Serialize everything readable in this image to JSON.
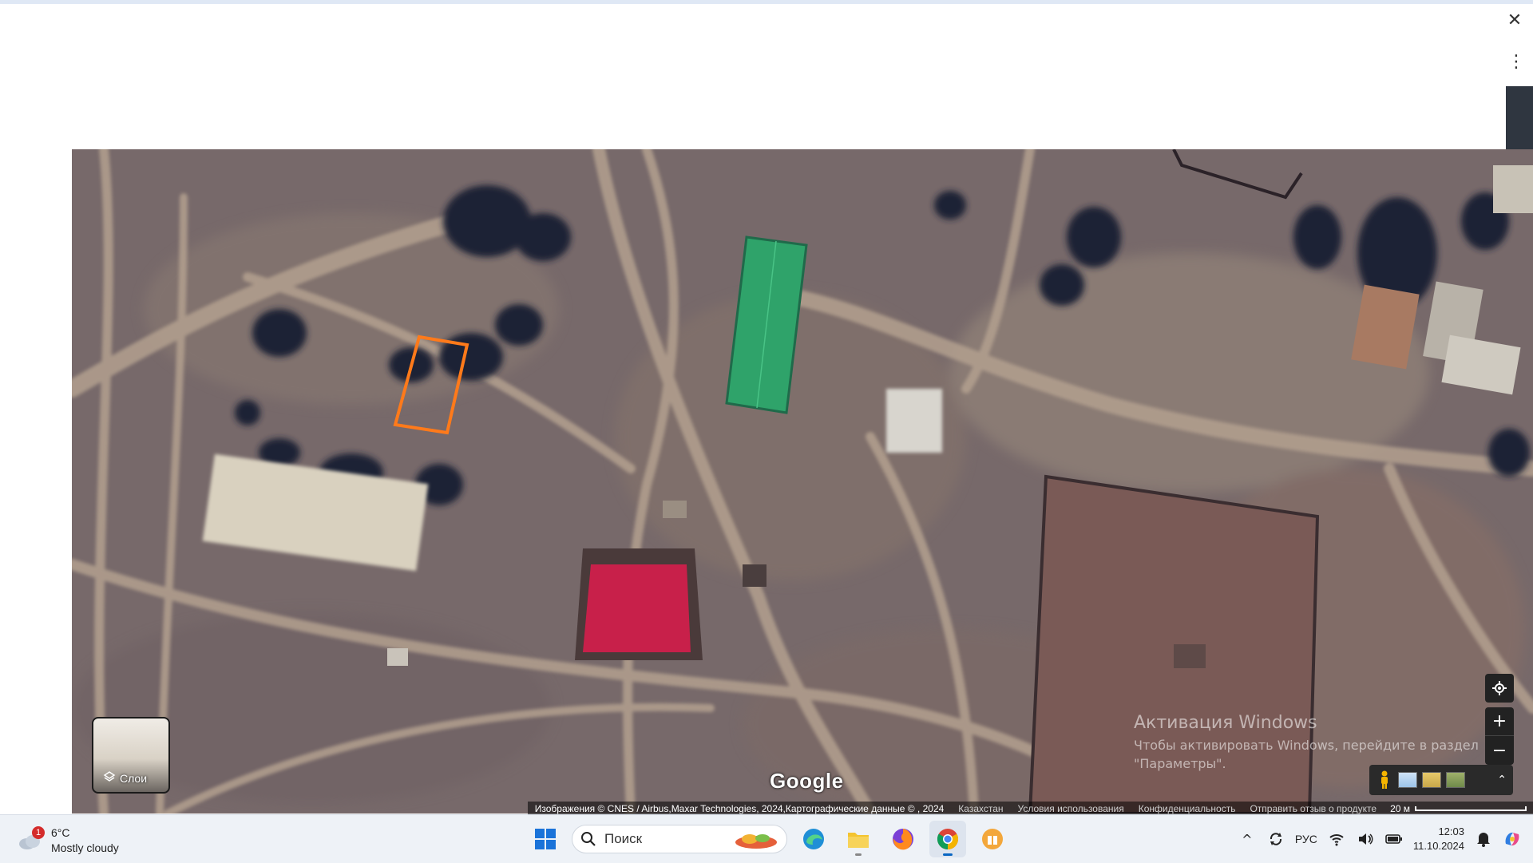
{
  "window": {
    "close_glyph": "✕",
    "menu_glyph": "⋮"
  },
  "map": {
    "layers_label": "Слои",
    "google_logo": "Google",
    "watermark": {
      "title": "Активация Windows",
      "line1": "Чтобы активировать Windows, перейдите в раздел",
      "line2": "\"Параметры\"."
    },
    "attribution": {
      "imagery": "Изображения © CNES / Airbus,Maxar Technologies, 2024,Картографические данные © , 2024",
      "region": "Казахстан",
      "terms": "Условия использования",
      "privacy": "Конфиденциальность",
      "feedback": "Отправить отзыв о продукте",
      "scale": "20 м"
    },
    "controls": {
      "zoom_in": "+",
      "zoom_out": "−",
      "expand": "⌃"
    }
  },
  "taskbar": {
    "weather": {
      "badge": "1",
      "temp": "6°C",
      "desc": "Mostly cloudy"
    },
    "search_placeholder": "Поиск",
    "tray": {
      "lang": "РУС",
      "time": "12:03",
      "date": "11.10.2024"
    }
  },
  "colors": {
    "pitch": "#2fa36a",
    "roof_red": "#c8204a",
    "selection": "#ff7a1a",
    "taskbar_bg": "#eef2f7"
  }
}
